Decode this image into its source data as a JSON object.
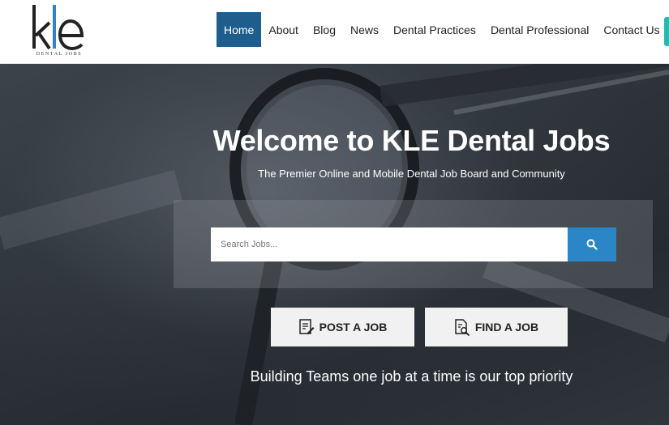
{
  "logo": {
    "mark": "kle",
    "subtitle": "DENTAL JOBS"
  },
  "nav": {
    "items": [
      {
        "label": "Home",
        "active": true
      },
      {
        "label": "About"
      },
      {
        "label": "Blog"
      },
      {
        "label": "News"
      },
      {
        "label": "Dental Practices"
      },
      {
        "label": "Dental Professional"
      },
      {
        "label": "Contact Us"
      }
    ]
  },
  "hero": {
    "title": "Welcome to KLE Dental Jobs",
    "subtitle": "The Premier Online and Mobile Dental Job Board and Community",
    "tagline": "Building Teams one job at a time is our top priority"
  },
  "search": {
    "placeholder": "Search Jobs...",
    "icon": "search-icon"
  },
  "actions": {
    "post_label": "POST A JOB",
    "post_icon": "document-edit-icon",
    "find_label": "FIND A JOB",
    "find_icon": "document-search-icon"
  },
  "colors": {
    "nav_active": "#1f5d8c",
    "search_button": "#2a86c7",
    "accent": "#2bb6b0"
  }
}
